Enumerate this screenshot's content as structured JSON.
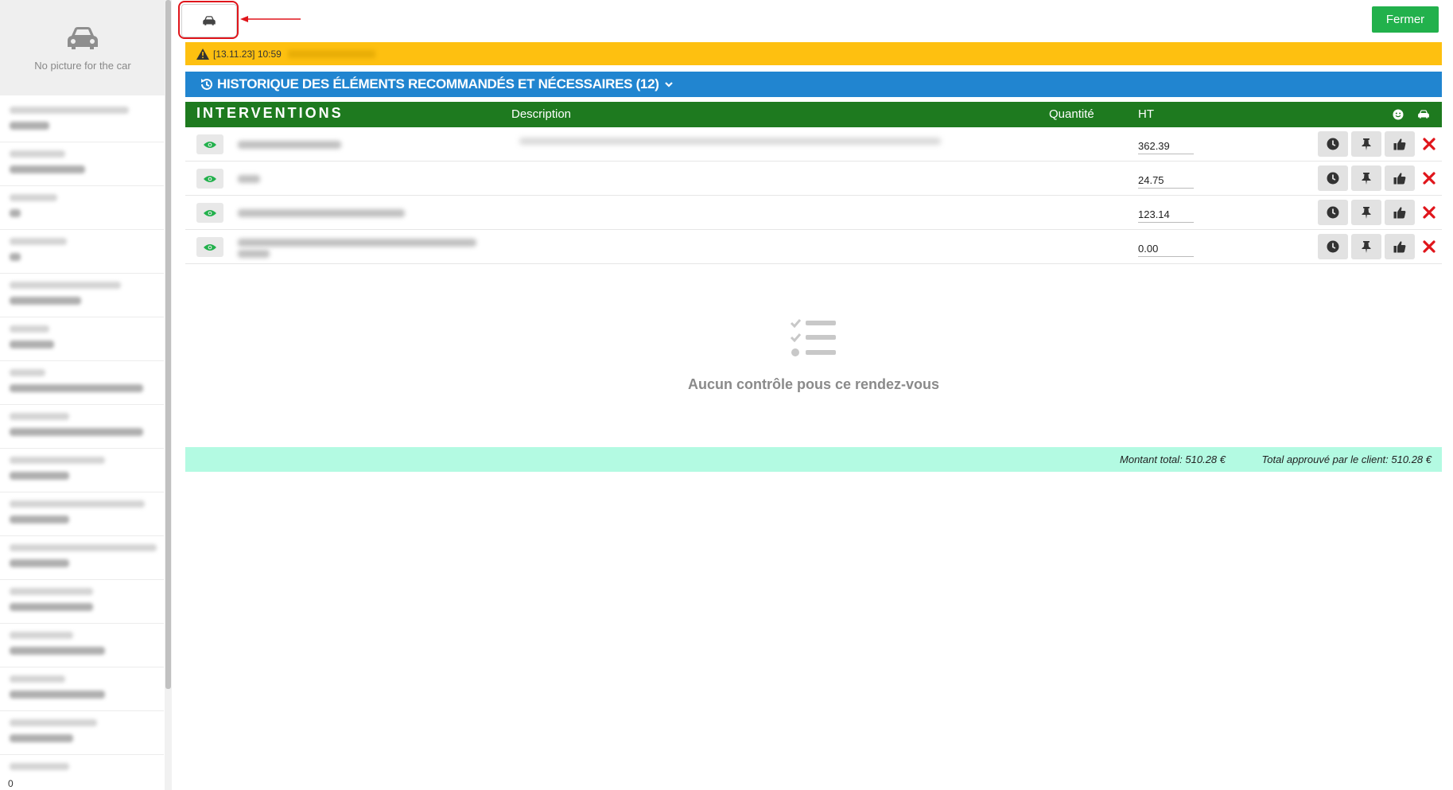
{
  "sidebar": {
    "no_picture_label": "No picture for the car",
    "bottom_value": "0"
  },
  "toolbar": {
    "car_tab_icon": "car-icon",
    "close_label": "Fermer"
  },
  "warning": {
    "text": "[13.11.23] 10:59"
  },
  "history": {
    "title": "HISTORIQUE DES ÉLÉMENTS RECOMMANDÉS ET NÉCESSAIRES (12)"
  },
  "table": {
    "headers": {
      "interventions": "INTERVENTIONS",
      "description": "Description",
      "quantity": "Quantité",
      "ht": "HT"
    },
    "rows": [
      {
        "ht": "362.39"
      },
      {
        "ht": "24.75"
      },
      {
        "ht": "123.14"
      },
      {
        "ht": "0.00"
      }
    ]
  },
  "empty_state": {
    "text": "Aucun contrôle pous ce rendez-vous"
  },
  "totals": {
    "amount": "Montant total: 510.28 €",
    "approved": "Total approuvé par le client: 510.28 €"
  },
  "colors": {
    "warning": "#fec010",
    "history": "#2185d0",
    "table_header": "#1e7a1f",
    "close_button": "#22b14c",
    "totals": "#b3fae2",
    "delete": "#e0151b"
  }
}
